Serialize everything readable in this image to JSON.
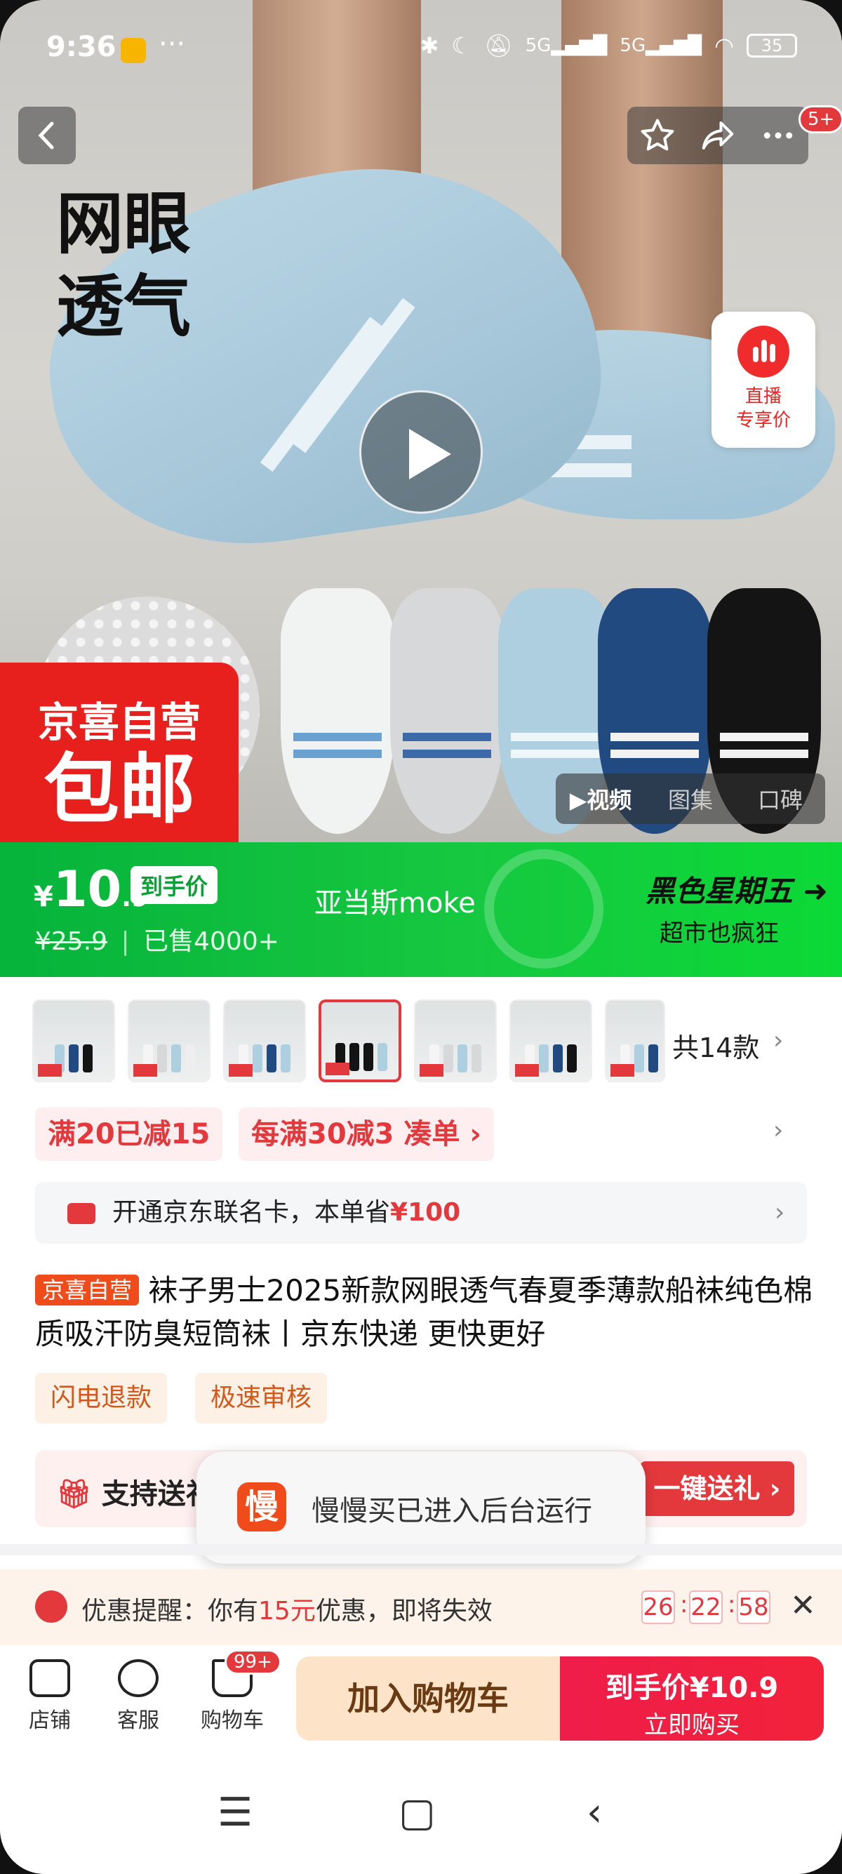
{
  "status_bar": {
    "time": "9:36",
    "more": "···",
    "battery": "35"
  },
  "hero": {
    "title_line1": "网眼",
    "title_line2": "透气",
    "live_line1": "直播",
    "live_line2": "专享价",
    "promo_line1": "京喜自营",
    "promo_line2": "包邮",
    "cart_badge": "5+",
    "media_tabs": [
      "▶视频",
      "图集",
      "口碑"
    ]
  },
  "price_banner": {
    "currency": "¥",
    "price_int": "10",
    "price_dec": ".9",
    "price_label": "到手价",
    "original_price": "¥25.9",
    "separator": "|",
    "sold": "已售4000+",
    "shop_name": "亚当斯moke",
    "event_title": "黑色星期五",
    "event_sub": "超市也疯狂"
  },
  "variants": {
    "count_text": "共14款"
  },
  "coupons": [
    "满20已减15",
    "每满30减3 凑单 ›"
  ],
  "card_offer": {
    "text": "开通京东联名卡，本单省",
    "amount": "¥100"
  },
  "product": {
    "tag": "京喜自营",
    "title": "袜子男士2025新款网眼透气春夏季薄款船袜纯色棉质吸汗防臭短筒袜丨京东快递 更快更好"
  },
  "services": [
    "闪电退款",
    "极速审核"
  ],
  "gift": {
    "label": "支持送礼",
    "button": "一键送礼 ›"
  },
  "toast": {
    "icon_char": "慢",
    "text": "慢慢买已进入后台运行"
  },
  "reminder": {
    "prefix": "优惠提醒：你有",
    "amount": "15元",
    "suffix": "优惠，即将失效",
    "h": "26",
    "m": "22",
    "s": "58"
  },
  "bottom_bar": {
    "shop": "店铺",
    "service": "客服",
    "cart": "购物车",
    "cart_badge": "99+",
    "add_to_cart": "加入购物车",
    "buy_line1": "到手价¥10.9",
    "buy_line2": "立即购买"
  },
  "colors": {
    "jd_red": "#e4393c",
    "banner_green": "#16c840",
    "accent_orange": "#f04c1b"
  }
}
